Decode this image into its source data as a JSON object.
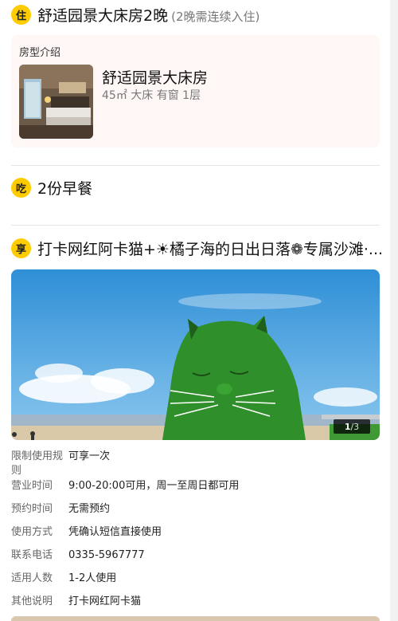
{
  "stay": {
    "badge": "住",
    "title": "舒适园景大床房2晚",
    "subtitle": "(2晚需连续入住)",
    "card_label": "房型介绍",
    "room_name": "舒适园景大床房",
    "room_specs": "45㎡  大床  有窗  1层"
  },
  "eat": {
    "badge": "吃",
    "title": "2份早餐"
  },
  "enjoy": {
    "badge": "享",
    "title": "打卡网红阿卡猫+☀橘子海的日出日落❁专属沙滩·...",
    "photo_counter_current": "1",
    "photo_counter_total": "/3",
    "details": [
      {
        "label": "限制使用规则",
        "value": "可享一次"
      },
      {
        "label": "营业时间",
        "value": "9:00-20:00可用，周一至周日都可用"
      },
      {
        "label": "预约时间",
        "value": "无需预约"
      },
      {
        "label": "使用方式",
        "value": "凭确认短信直接使用"
      },
      {
        "label": "联系电话",
        "value": "0335-5967777"
      },
      {
        "label": "适用人数",
        "value": "1-2人使用"
      },
      {
        "label": "其他说明",
        "value": "打卡网红阿卡猫"
      }
    ]
  },
  "colors": {
    "badge": "#ffcc00",
    "card_bg": "#fff7f6",
    "sky": "#3f9ddb",
    "grass_cat": "#2f8f2a"
  }
}
